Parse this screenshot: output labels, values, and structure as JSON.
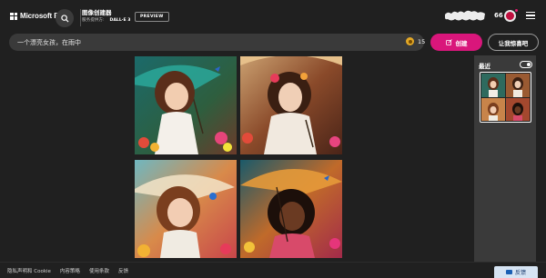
{
  "header": {
    "brand_name": "Microsoft Bing",
    "creator_title": "图像创建器",
    "powered_by": "服务提供方:",
    "model": "DALL·E 3",
    "preview_badge": "PREVIEW",
    "coins": "66"
  },
  "prompt": {
    "value": "一个漂亮女孩，在雨中",
    "boost_count": "15"
  },
  "actions": {
    "create_label": "创建",
    "surprise_label": "让我惊喜吧"
  },
  "recent": {
    "label": "最近"
  },
  "footer": {
    "links": [
      "隐私声明和 Cookie",
      "内容策略",
      "使用条款",
      "反馈"
    ],
    "feedback_label": "反馈"
  },
  "colors": {
    "page_bg": "#202020",
    "accent_pink": "#d9167b",
    "panel_bg": "#3a3a3a"
  }
}
